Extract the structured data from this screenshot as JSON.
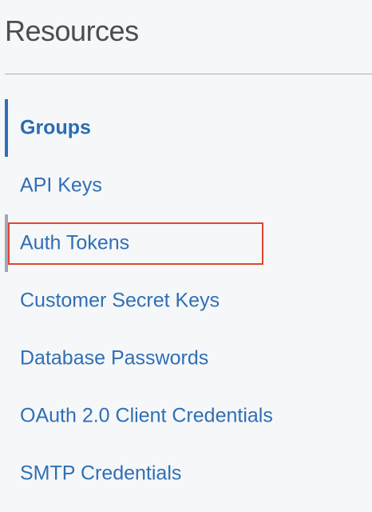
{
  "sidebar": {
    "title": "Resources",
    "items": [
      {
        "label": "Groups",
        "active": true
      },
      {
        "label": "API Keys"
      },
      {
        "label": "Auth Tokens",
        "highlighted": true
      },
      {
        "label": "Customer Secret Keys"
      },
      {
        "label": "Database Passwords"
      },
      {
        "label": "OAuth 2.0 Client Credentials"
      },
      {
        "label": "SMTP Credentials"
      }
    ]
  },
  "colors": {
    "link": "#2f6fb6",
    "active_indicator": "#2f6fb6",
    "highlight_border": "#e0452f",
    "background": "#f6f7f9"
  }
}
